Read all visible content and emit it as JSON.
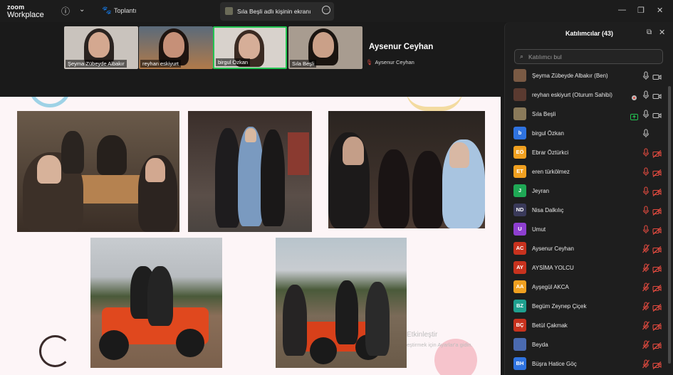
{
  "app": {
    "logo_line1": "zoom",
    "logo_line2": "Workplace"
  },
  "titlebar": {
    "info_icon": "info-icon",
    "dropdown_icon": "chevron-down-icon",
    "meetings_label": "Toplantı",
    "share_tab_label": "Sıla Beşli adlı kişinin ekranı",
    "share_more_icon": "more-icon",
    "minimize_icon": "minimize-icon",
    "restore_icon": "restore-icon",
    "close_icon": "close-icon"
  },
  "gallery": {
    "tiles": [
      {
        "name": "Şeyma Zübeyde Albakır"
      },
      {
        "name": "reyhan eskiyurt"
      },
      {
        "name": "birgul Özkan"
      },
      {
        "name": "Sıla Beşli"
      }
    ],
    "active_speaker": "Aysenur Ceyhan",
    "active_speaker_tag": "Aysenur Ceyhan"
  },
  "shared_screen": {
    "watermark_title": "Etkinleştir",
    "watermark_sub": "eştirmek için Ayarlar'a gidin."
  },
  "panel": {
    "title": "Katılımcılar (43)",
    "search_placeholder": "Katılımcı bul",
    "participants": [
      {
        "name": "Şeyma Zübeyde Albakır (Ben)",
        "initials": "",
        "color": "#7a5a44",
        "mic": "on",
        "cam": "on"
      },
      {
        "name": "reyhan eskiyurt (Oturum Sahibi)",
        "initials": "",
        "color": "#5a3a30",
        "mic": "on",
        "cam": "on"
      },
      {
        "name": "Sıla Beşli",
        "initials": "",
        "color": "#8a7a5a",
        "mic": "on",
        "cam": "on"
      },
      {
        "name": "birgul Özkan",
        "initials": "b",
        "color": "#2f73e0",
        "mic": "on",
        "cam": "none"
      },
      {
        "name": "Ebrar Öztürkci",
        "initials": "EÖ",
        "color": "#f0a020",
        "mic": "muted",
        "cam": "off"
      },
      {
        "name": "eren türkölmez",
        "initials": "ET",
        "color": "#f0a020",
        "mic": "muted",
        "cam": "off"
      },
      {
        "name": "Jeyran",
        "initials": "J",
        "color": "#1fa855",
        "mic": "muted",
        "cam": "off"
      },
      {
        "name": "Nisa Dalkılıç",
        "initials": "ND",
        "color": "#3a3a5a",
        "mic": "muted",
        "cam": "off"
      },
      {
        "name": "Umut",
        "initials": "U",
        "color": "#8e3fd0",
        "mic": "muted",
        "cam": "off"
      },
      {
        "name": "Aysenur Ceyhan",
        "initials": "AC",
        "color": "#c8321e",
        "mic": "off",
        "cam": "off"
      },
      {
        "name": "AYSİMA YOLCU",
        "initials": "AY",
        "color": "#c8321e",
        "mic": "off",
        "cam": "off"
      },
      {
        "name": "Ayşegül AKCA",
        "initials": "AA",
        "color": "#f0a020",
        "mic": "off",
        "cam": "off"
      },
      {
        "name": "Begüm Zeynep Çiçek",
        "initials": "BZ",
        "color": "#1fa08f",
        "mic": "off",
        "cam": "off"
      },
      {
        "name": "Betül Çakmak",
        "initials": "BÇ",
        "color": "#c8321e",
        "mic": "off",
        "cam": "off"
      },
      {
        "name": "Beyda",
        "initials": "",
        "color": "#4a6ab0",
        "mic": "off",
        "cam": "off"
      },
      {
        "name": "Büşra Hatice Göç",
        "initials": "BH",
        "color": "#2f73e0",
        "mic": "off",
        "cam": "off"
      }
    ]
  },
  "colors": {
    "active_border": "#23c552",
    "muted_red": "#e04a3f",
    "panel_bg": "#1e1e1e"
  }
}
